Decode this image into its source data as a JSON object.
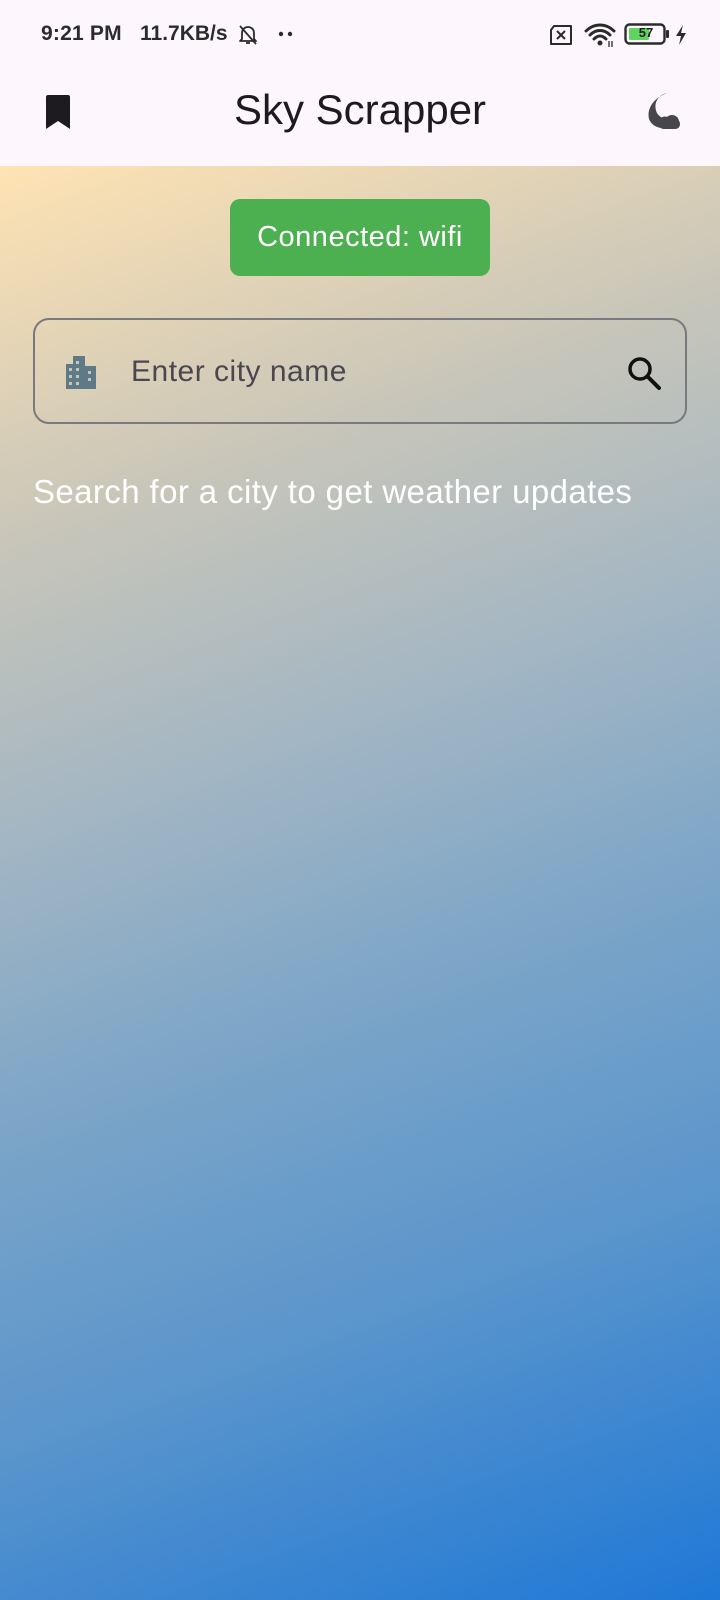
{
  "status_bar": {
    "time": "9:21 PM",
    "network_speed": "11.7KB/s",
    "battery_level": "57",
    "icons": [
      "bell-off-icon",
      "more-dots-icon",
      "sim-x-icon",
      "wifi-icon",
      "battery-icon",
      "charging-icon"
    ]
  },
  "app_bar": {
    "title": "Sky Scrapper",
    "left_icon": "bookmark-icon",
    "right_icon": "dark-mode-icon"
  },
  "connection": {
    "label": "Connected: wifi",
    "color": "#4caf50"
  },
  "search": {
    "placeholder": "Enter city name",
    "value": "",
    "prefix_icon": "city-icon",
    "suffix_icon": "search-icon"
  },
  "hint": "Search for a city to get weather updates"
}
